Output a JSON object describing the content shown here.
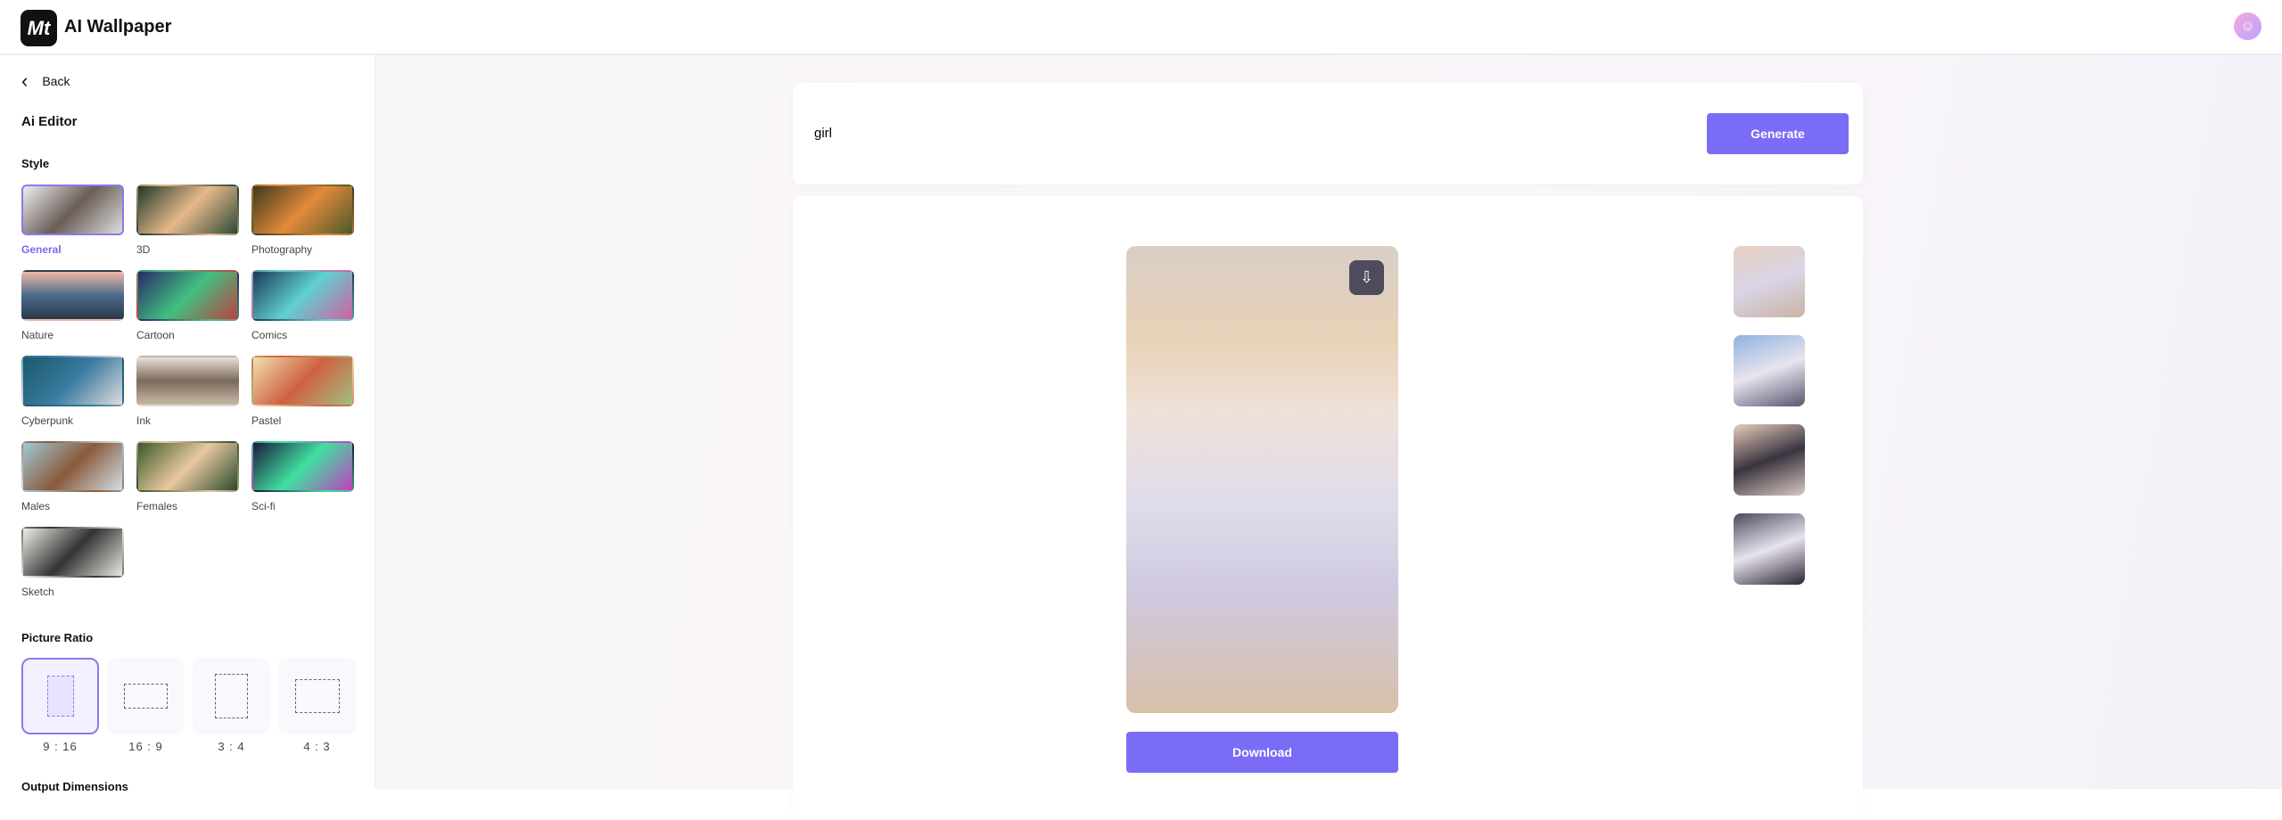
{
  "header": {
    "logo_text": "Mt",
    "title": "AI Wallpaper",
    "avatar_icon": "user-icon"
  },
  "sidebar": {
    "back_label": "Back",
    "section_title": "Ai Editor",
    "style_label": "Style",
    "styles": [
      {
        "label": "General",
        "selected": true
      },
      {
        "label": "3D"
      },
      {
        "label": "Photography"
      },
      {
        "label": "Nature"
      },
      {
        "label": "Cartoon"
      },
      {
        "label": "Comics"
      },
      {
        "label": "Cyberpunk"
      },
      {
        "label": "Ink"
      },
      {
        "label": "Pastel"
      },
      {
        "label": "Males"
      },
      {
        "label": "Females"
      },
      {
        "label": "Sci-fi"
      },
      {
        "label": "Sketch"
      }
    ],
    "ratio_label": "Picture Ratio",
    "ratios": [
      {
        "label": "9 : 16",
        "selected": true
      },
      {
        "label": "16 : 9"
      },
      {
        "label": "3 : 4"
      },
      {
        "label": "4 : 3"
      }
    ],
    "output_label": "Output Dimensions"
  },
  "main": {
    "prompt_value": "girl",
    "generate_label": "Generate",
    "download_label": "Download",
    "accent_color": "#7b6cf6"
  }
}
